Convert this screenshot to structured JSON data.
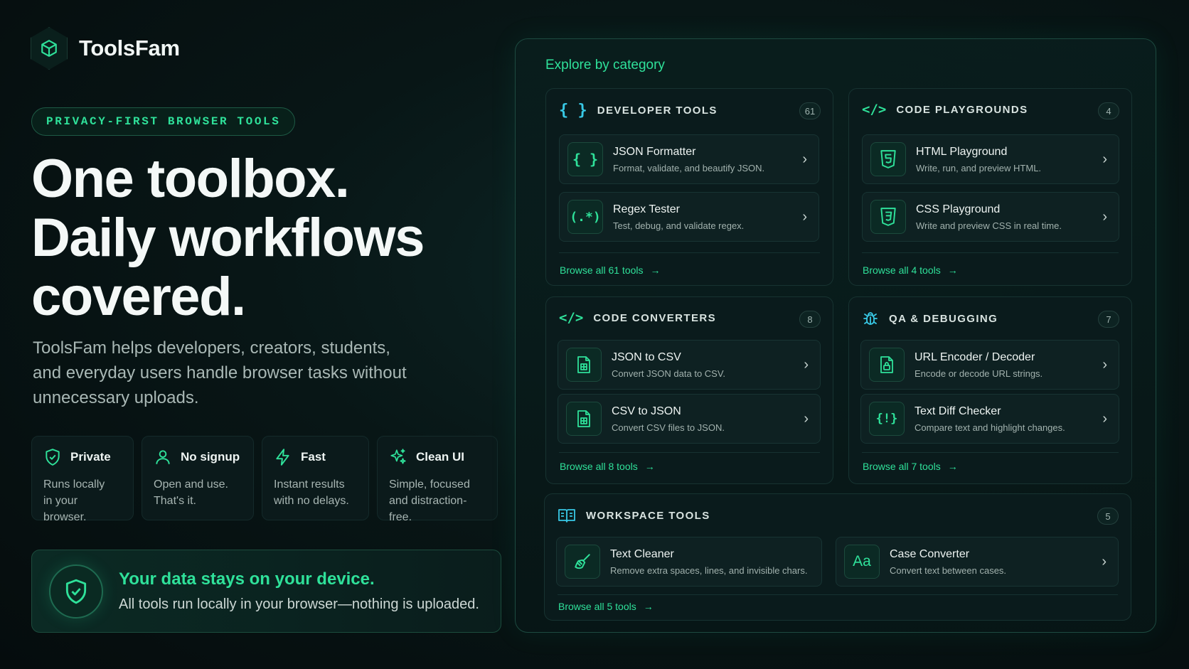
{
  "brand": {
    "name": "ToolsFam"
  },
  "hero": {
    "pill": "PRIVACY-FIRST BROWSER TOOLS",
    "headline": [
      "One toolbox.",
      "Daily workflows",
      "covered."
    ],
    "lead": "ToolsFam helps developers, creators, students, and everyday users handle browser tasks without unnecessary uploads."
  },
  "features": [
    {
      "icon": "shield-check-icon",
      "title": "Private",
      "line1": "Runs locally",
      "line2": "in your browser."
    },
    {
      "icon": "user-icon",
      "title": "No signup",
      "line1": "Open and use.",
      "line2": "That's it."
    },
    {
      "icon": "lightning-icon",
      "title": "Fast",
      "line1": "Instant results",
      "line2": "with no delays."
    },
    {
      "icon": "sparkles-icon",
      "title": "Clean UI",
      "line1": "Simple, focused",
      "line2": "and distraction-free."
    }
  ],
  "privacy": {
    "title": "Your data stays on your device.",
    "text": "All tools run locally in your browser—nothing is uploaded."
  },
  "panel": {
    "title": "Explore by category",
    "categories": [
      {
        "title": "DEVELOPER TOOLS",
        "count": "61",
        "icon": "braces-icon",
        "tools": [
          {
            "name": "JSON Formatter",
            "desc": "Format, validate, and beautify JSON.",
            "icon": "braces-icon",
            "glyph": "{ }"
          },
          {
            "name": "Regex Tester",
            "desc": "Test, debug, and validate regex.",
            "icon": "regex-icon",
            "glyph": "(.*)"
          }
        ],
        "browse": "Browse all 61 tools"
      },
      {
        "title": "CODE PLAYGROUNDS",
        "count": "4",
        "icon": "code-icon",
        "tools": [
          {
            "name": "HTML Playground",
            "desc": "Write, run, and preview HTML.",
            "icon": "html5-icon",
            "glyph": "5"
          },
          {
            "name": "CSS Playground",
            "desc": "Write and preview CSS in real time.",
            "icon": "css3-icon",
            "glyph": "3"
          }
        ],
        "browse": "Browse all 4 tools"
      },
      {
        "title": "CODE CONVERTERS",
        "count": "8",
        "icon": "code-icon",
        "tools": [
          {
            "name": "JSON to CSV",
            "desc": "Convert JSON data to CSV.",
            "icon": "file-table-icon",
            "glyph": ""
          },
          {
            "name": "CSV to JSON",
            "desc": "Convert CSV files to JSON.",
            "icon": "file-table-icon",
            "glyph": ""
          }
        ],
        "browse": "Browse all 8 tools"
      },
      {
        "title": "QA & DEBUGGING",
        "count": "7",
        "icon": "bug-icon",
        "tools": [
          {
            "name": "URL Encoder / Decoder",
            "desc": "Encode or decode URL strings.",
            "icon": "file-lock-icon",
            "glyph": ""
          },
          {
            "name": "Text Diff Checker",
            "desc": "Compare text and highlight changes.",
            "icon": "diff-icon",
            "glyph": "{!}"
          }
        ],
        "browse": "Browse all 7 tools"
      },
      {
        "title": "WORKSPACE TOOLS",
        "count": "5",
        "icon": "book-icon",
        "tools": [
          {
            "name": "Text Cleaner",
            "desc": "Remove extra spaces, lines, and invisible chars.",
            "icon": "broom-icon",
            "glyph": ""
          },
          {
            "name": "Case Converter",
            "desc": "Convert text between cases.",
            "icon": "case-icon",
            "glyph": "Aa"
          }
        ],
        "browse": "Browse all 5 tools"
      }
    ]
  },
  "colors": {
    "accent": "#2fe19a",
    "icon_cyan": "#38c9e6"
  }
}
